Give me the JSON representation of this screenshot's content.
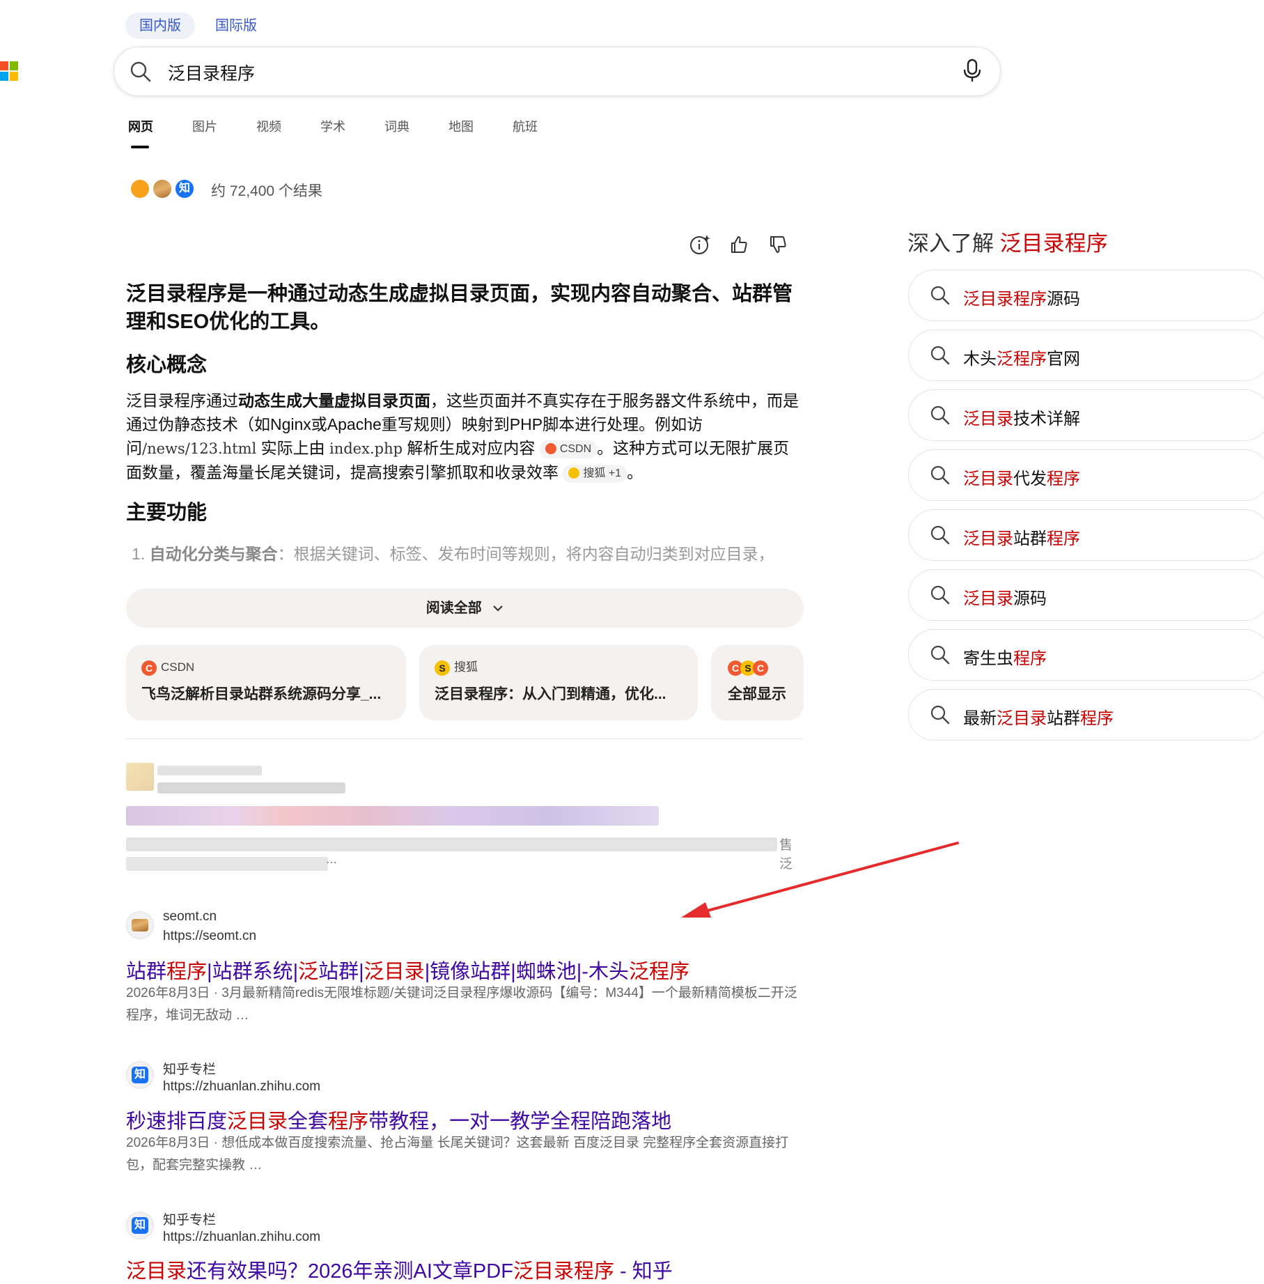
{
  "logo": {
    "name": "microsoft-logo",
    "colors": [
      "#f25022",
      "#7fba00",
      "#00a4ef",
      "#ffb900"
    ]
  },
  "market_tabs": [
    {
      "label": "国内版",
      "active": true
    },
    {
      "label": "国际版",
      "active": false
    }
  ],
  "search": {
    "query": "泛目录程序"
  },
  "nav_tabs": [
    {
      "label": "网页",
      "active": true
    },
    {
      "label": "图片",
      "active": false
    },
    {
      "label": "视频",
      "active": false
    },
    {
      "label": "学术",
      "active": false
    },
    {
      "label": "词典",
      "active": false
    },
    {
      "label": "地图",
      "active": false
    },
    {
      "label": "航班",
      "active": false
    }
  ],
  "results_count": "约 72,400 个结果",
  "answer": {
    "title": "泛目录程序是一种通过动态生成虚拟目录页面，实现内容自动聚合、站群管理和SEO优化的工具。",
    "section1_heading": "核心概念",
    "section1": {
      "p1": "泛目录程序通过",
      "p1_bold": "动态生成大量虚拟目录页面",
      "p2": "，这些页面并不真实存在于服务器文件系统中，而是通过伪静态技术（如Nginx或Apache重写规则）映射到PHP脚本进行处理。例如访问",
      "code1": "/news/123.html",
      "p3": " 实际上由 ",
      "code2": "index.php",
      "p4": " 解析生成对应内容",
      "cite1": "CSDN",
      "p5": "。这种方式可以无限扩展页面数量，覆盖海量长尾关键词，提高搜索引擎抓取和收录效率",
      "cite2": "搜狐 +1",
      "p6": "。"
    },
    "section2_heading": "主要功能",
    "list_item1_num": "1.",
    "list_item1_bold": "自动化分类与聚合",
    "list_item1_text": "：根据关键词、标签、发布时间等规则，将内容自动归类到对应目录，",
    "read_all": "阅读全部"
  },
  "source_cards": [
    {
      "site": "CSDN",
      "title": "飞鸟泛解析目录站群系统源码分享_..."
    },
    {
      "site": "搜狐",
      "title": "泛目录程序：从入门到精通，优化..."
    },
    {
      "site": "",
      "title": "全部显示"
    }
  ],
  "blurred_result": {
    "visible_fragment": "售泛",
    "ellipsis": "..."
  },
  "results": [
    {
      "site_name": "seomt.cn",
      "url": "https://seomt.cn",
      "title_parts": [
        {
          "t": "站群",
          "hl": false
        },
        {
          "t": "程序",
          "hl": true
        },
        {
          "t": "|站群系统|",
          "hl": false
        },
        {
          "t": "泛",
          "hl": true
        },
        {
          "t": "站群|",
          "hl": false
        },
        {
          "t": "泛目录",
          "hl": true
        },
        {
          "t": "|镜像站群|蜘蛛池|-木头",
          "hl": false
        },
        {
          "t": "泛程序",
          "hl": true
        }
      ],
      "date": "2026年8月3日",
      "snippet": "3月最新精简redis无限堆标题/关键词泛目录程序爆收源码【编号：M344】一个最新精简模板二开泛程序，堆词无敌动 …"
    },
    {
      "site_name": "知乎专栏",
      "url": "https://zhuanlan.zhihu.com",
      "title_parts": [
        {
          "t": "秒速排百度",
          "hl": false
        },
        {
          "t": "泛目录",
          "hl": true
        },
        {
          "t": "全套",
          "hl": false
        },
        {
          "t": "程序",
          "hl": true
        },
        {
          "t": "带教程，一对一教学全程陪跑落地",
          "hl": false
        }
      ],
      "date": "2026年8月3日",
      "snippet": "想低成本做百度搜索流量、抢占海量 长尾关键词？这套最新 百度泛目录 完整程序全套资源直接打包，配套完整实操教 …"
    },
    {
      "site_name": "知乎专栏",
      "url": "https://zhuanlan.zhihu.com",
      "title_parts": [
        {
          "t": "泛目录",
          "hl": true
        },
        {
          "t": "还有效果吗？2026年亲测AI文章PDF",
          "hl": false
        },
        {
          "t": "泛目录程序",
          "hl": true
        },
        {
          "t": " - 知乎",
          "hl": false
        }
      ],
      "date": "",
      "snippet": ""
    }
  ],
  "sidebar": {
    "heading_prefix": "深入了解 ",
    "heading_highlight": "泛目录程序",
    "related": [
      [
        {
          "t": "泛目录程序",
          "hl": true
        },
        {
          "t": "源码",
          "hl": false
        }
      ],
      [
        {
          "t": "木头",
          "hl": false
        },
        {
          "t": "泛程序",
          "hl": true
        },
        {
          "t": "官网",
          "hl": false
        }
      ],
      [
        {
          "t": "泛目录",
          "hl": true
        },
        {
          "t": "技术详解",
          "hl": false
        }
      ],
      [
        {
          "t": "泛目录",
          "hl": true
        },
        {
          "t": "代发",
          "hl": false
        },
        {
          "t": "程序",
          "hl": true
        }
      ],
      [
        {
          "t": "泛目录",
          "hl": true
        },
        {
          "t": "站群",
          "hl": false
        },
        {
          "t": "程序",
          "hl": true
        }
      ],
      [
        {
          "t": "泛目录",
          "hl": true
        },
        {
          "t": "源码",
          "hl": false
        }
      ],
      [
        {
          "t": "寄生虫",
          "hl": false
        },
        {
          "t": "程序",
          "hl": true
        }
      ],
      [
        {
          "t": "最新",
          "hl": false
        },
        {
          "t": "泛目录",
          "hl": true
        },
        {
          "t": "站群",
          "hl": false
        },
        {
          "t": "程序",
          "hl": true
        }
      ]
    ]
  },
  "annotation": {
    "arrow_color": "#e52b2b"
  },
  "colors": {
    "link": "#4007a2",
    "highlight": "#c80000",
    "market_link": "#3657c9"
  }
}
